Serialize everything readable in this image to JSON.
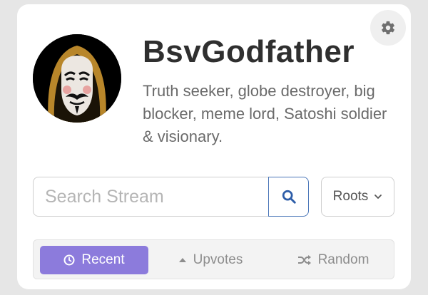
{
  "profile": {
    "name": "BsvGodfather",
    "bio": "Truth seeker, globe destroyer, big blocker, meme lord, Satoshi soldier & visionary.",
    "avatar_icon": "guy-fawkes-mask-hooded-avatar"
  },
  "settings": {
    "icon": "gear-icon"
  },
  "search": {
    "placeholder": "Search Stream",
    "value": "",
    "button_icon": "search-icon"
  },
  "filter": {
    "selected": "Roots",
    "icon": "chevron-down-icon"
  },
  "tabs": [
    {
      "label": "Recent",
      "icon": "clock-icon",
      "active": true
    },
    {
      "label": "Upvotes",
      "icon": "caret-up-icon",
      "active": false
    },
    {
      "label": "Random",
      "icon": "shuffle-icon",
      "active": false
    }
  ],
  "colors": {
    "accent": "#8c7bdc",
    "search_border": "#4a76b8",
    "name_text": "#2f2f2f",
    "bio_text": "#6a6a6a"
  }
}
